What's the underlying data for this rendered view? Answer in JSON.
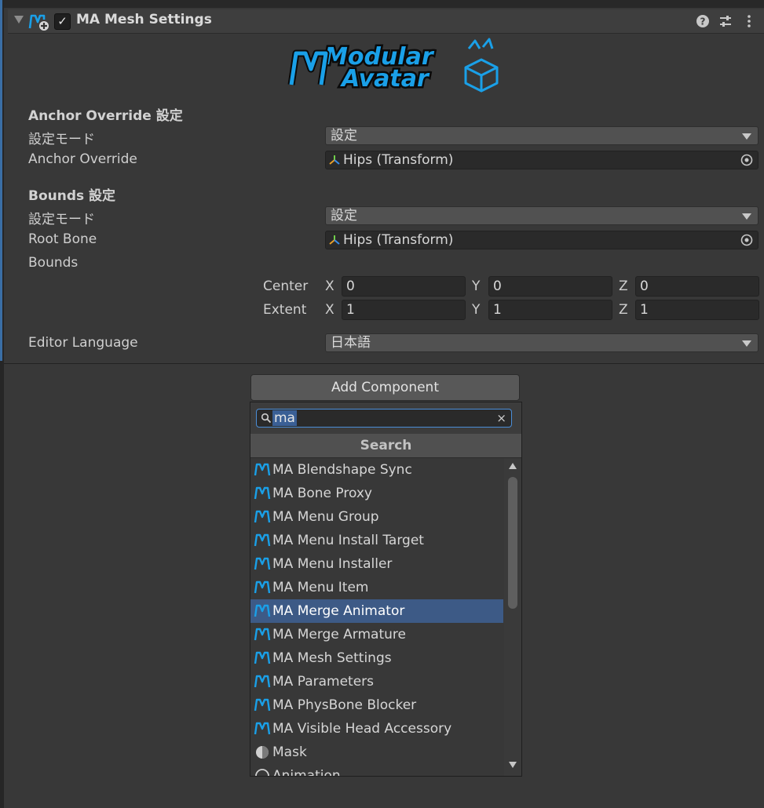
{
  "component": {
    "title": "MA Mesh Settings",
    "enabled": true
  },
  "logo": {
    "line1": "Modular",
    "line2": "Avatar"
  },
  "anchor": {
    "section": "Anchor Override 設定",
    "mode_label": "設定モード",
    "mode_value": "設定",
    "field_label": "Anchor Override",
    "field_value": "Hips (Transform)"
  },
  "bounds": {
    "section": "Bounds 設定",
    "mode_label": "設定モード",
    "mode_value": "設定",
    "root_label": "Root Bone",
    "root_value": "Hips (Transform)",
    "bounds_label": "Bounds",
    "center_label": "Center",
    "extent_label": "Extent",
    "axis_x": "X",
    "axis_y": "Y",
    "axis_z": "Z",
    "center": {
      "x": "0",
      "y": "0",
      "z": "0"
    },
    "extent": {
      "x": "1",
      "y": "1",
      "z": "1"
    }
  },
  "language": {
    "label": "Editor Language",
    "value": "日本語"
  },
  "add_component": {
    "button_label": "Add Component",
    "search_value": "ma",
    "clear_glyph": "×",
    "header": "Search",
    "items": [
      "MA Blendshape Sync",
      "MA Bone Proxy",
      "MA Menu Group",
      "MA Menu Install Target",
      "MA Menu Installer",
      "MA Menu Item",
      "MA Merge Animator",
      "MA Merge Armature",
      "MA Mesh Settings",
      "MA Parameters",
      "MA PhysBone Blocker",
      "MA Visible Head Accessory",
      "Mask",
      "Animation"
    ],
    "selected_item": "MA Merge Animator"
  },
  "colors": {
    "background": "#383838",
    "selection": "#3d5a86",
    "accent_blue": "#1aa0e8",
    "search_border": "#4b8ed8"
  },
  "icons": [
    "modular-avatar-icon",
    "help-icon",
    "preset-icon",
    "kebab-menu-icon",
    "transform-icon",
    "object-picker-icon",
    "search-icon",
    "clear-icon",
    "mask-icon",
    "animation-icon"
  ]
}
